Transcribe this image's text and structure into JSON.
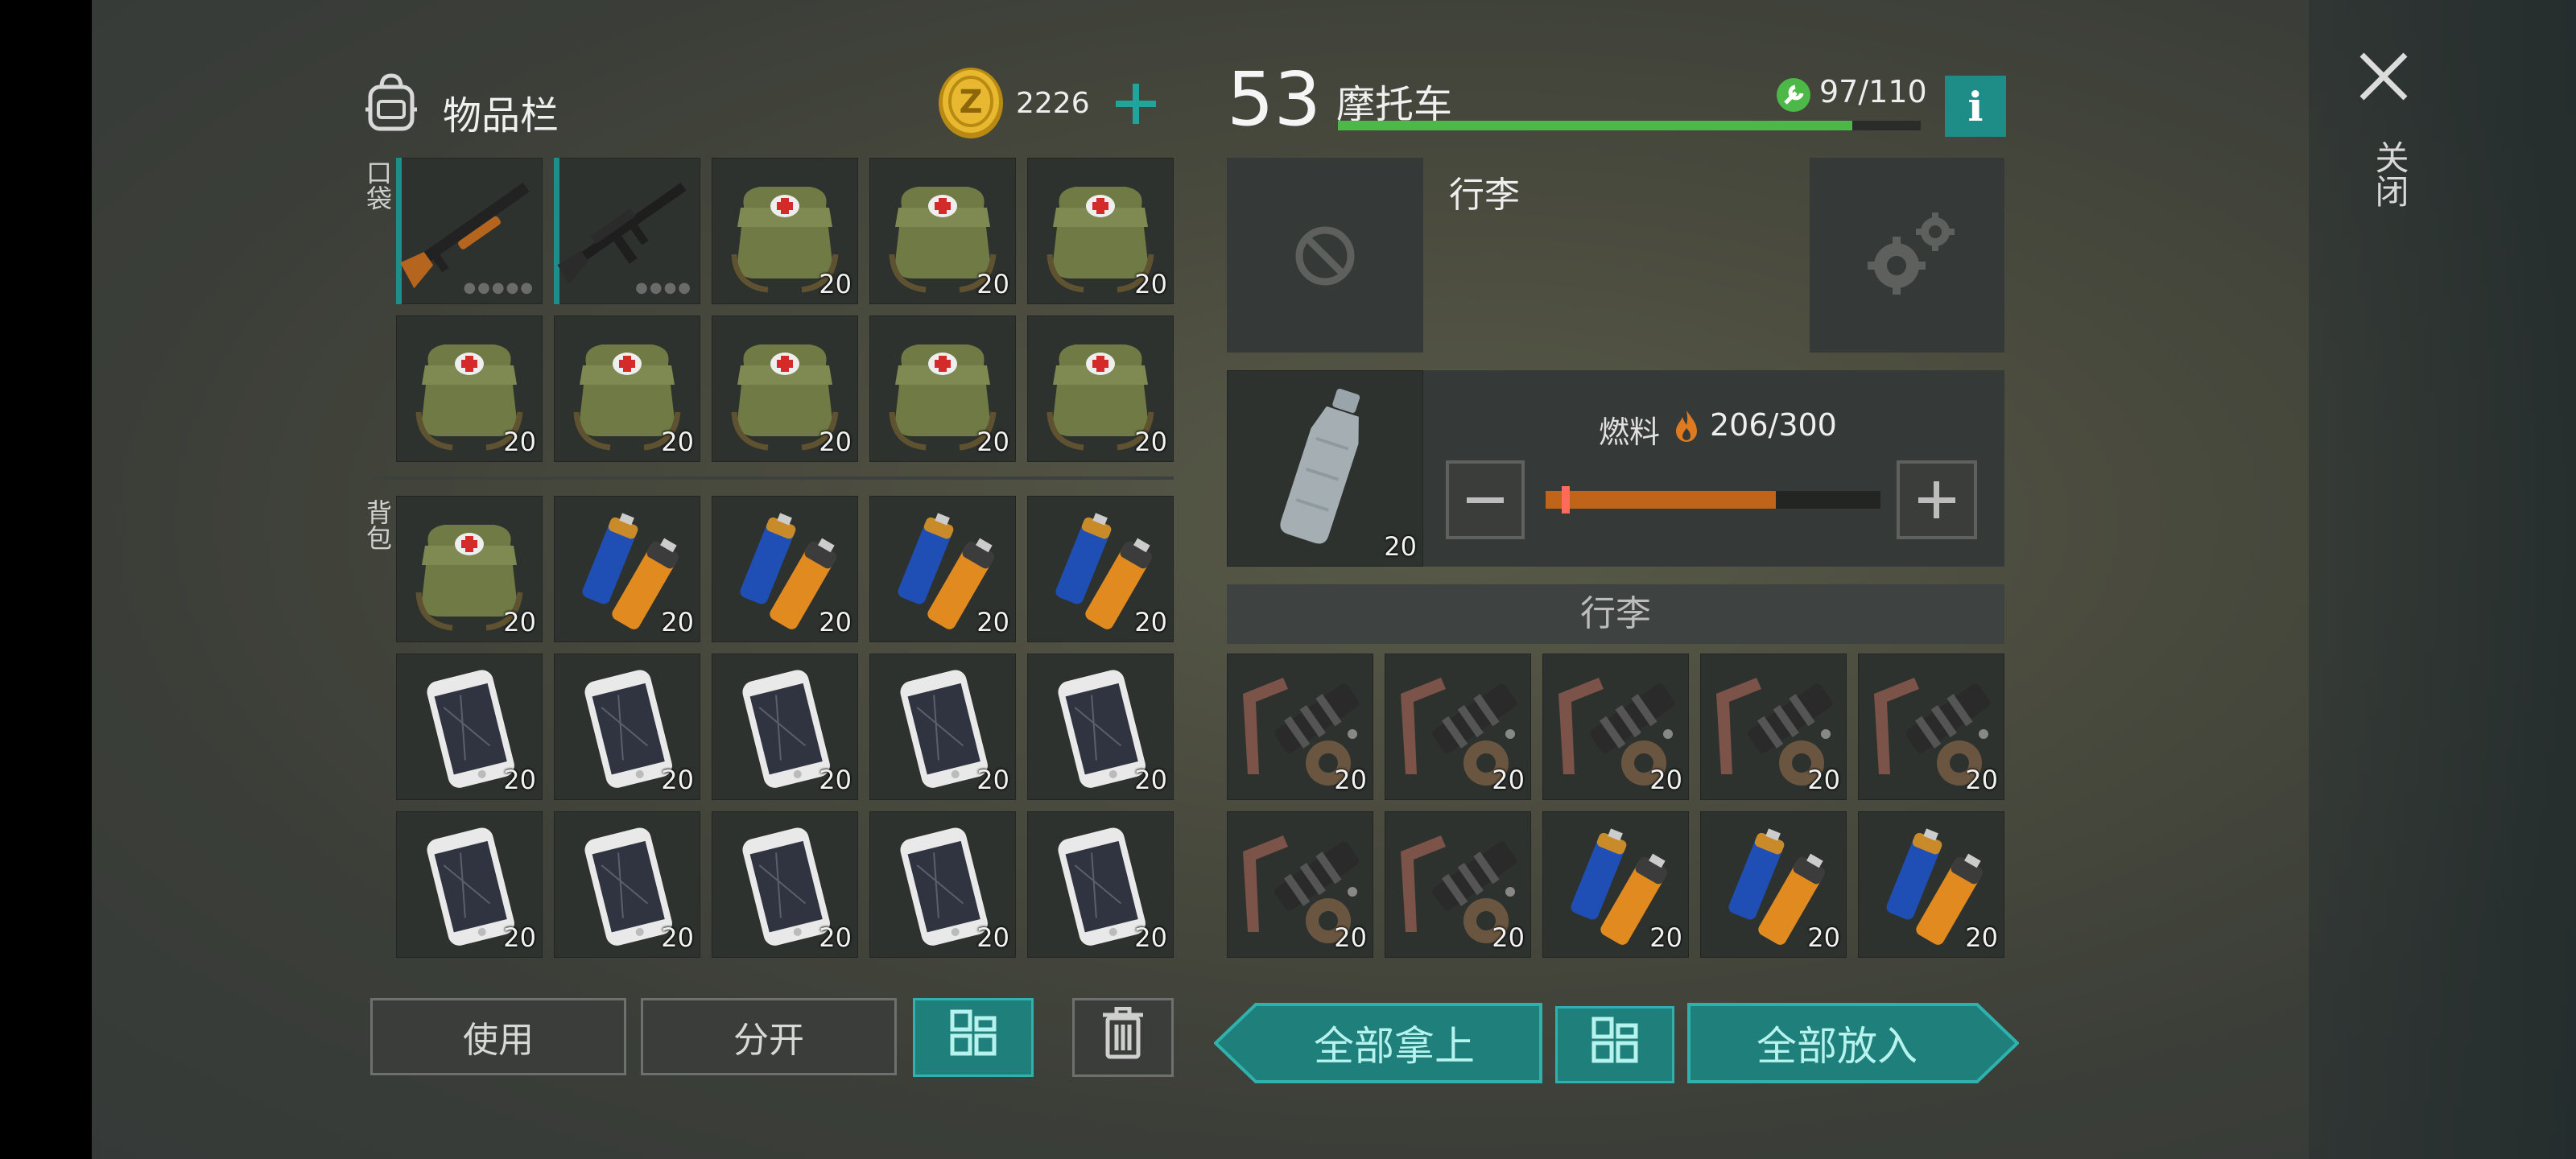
{
  "inventory": {
    "title": "物品栏",
    "currency": "2226",
    "pockets_label": "口袋",
    "backpack_label": "背包",
    "pockets": [
      {
        "icon": "shotgun-icon",
        "equipped": true,
        "dots": "●●●●●"
      },
      {
        "icon": "rifle-icon",
        "equipped": true,
        "dots": "●●●●"
      },
      {
        "icon": "medkit-icon",
        "qty": "20"
      },
      {
        "icon": "medkit-icon",
        "qty": "20"
      },
      {
        "icon": "medkit-icon",
        "qty": "20"
      },
      {
        "icon": "medkit-icon",
        "qty": "20"
      },
      {
        "icon": "medkit-icon",
        "qty": "20"
      },
      {
        "icon": "medkit-icon",
        "qty": "20"
      },
      {
        "icon": "medkit-icon",
        "qty": "20"
      },
      {
        "icon": "medkit-icon",
        "qty": "20"
      }
    ],
    "backpack": [
      {
        "icon": "medkit-icon",
        "qty": "20"
      },
      {
        "icon": "battery-icon",
        "qty": "20"
      },
      {
        "icon": "battery-icon",
        "qty": "20"
      },
      {
        "icon": "battery-icon",
        "qty": "20"
      },
      {
        "icon": "battery-icon",
        "qty": "20"
      },
      {
        "icon": "phone-icon",
        "qty": "20"
      },
      {
        "icon": "phone-icon",
        "qty": "20"
      },
      {
        "icon": "phone-icon",
        "qty": "20"
      },
      {
        "icon": "phone-icon",
        "qty": "20"
      },
      {
        "icon": "phone-icon",
        "qty": "20"
      },
      {
        "icon": "phone-icon",
        "qty": "20"
      },
      {
        "icon": "phone-icon",
        "qty": "20"
      },
      {
        "icon": "phone-icon",
        "qty": "20"
      },
      {
        "icon": "phone-icon",
        "qty": "20"
      },
      {
        "icon": "phone-icon",
        "qty": "20"
      }
    ],
    "use_label": "使用",
    "split_label": "分开"
  },
  "vehicle": {
    "level": "53",
    "name": "摩托车",
    "durability": "97/110",
    "durability_fraction": 0.882,
    "info_label": "i",
    "luggage_slot_label": "行李",
    "fuel_label": "燃料",
    "fuel_value": "206/300",
    "fuel_fraction": 0.687,
    "fuel_item_qty": "20",
    "luggage_header": "行李",
    "luggage": [
      {
        "icon": "motor-parts-icon",
        "qty": "20"
      },
      {
        "icon": "motor-parts-icon",
        "qty": "20"
      },
      {
        "icon": "motor-parts-icon",
        "qty": "20"
      },
      {
        "icon": "motor-parts-icon",
        "qty": "20"
      },
      {
        "icon": "motor-parts-icon",
        "qty": "20"
      },
      {
        "icon": "motor-parts-icon",
        "qty": "20"
      },
      {
        "icon": "motor-parts-icon",
        "qty": "20"
      },
      {
        "icon": "battery-icon",
        "qty": "20"
      },
      {
        "icon": "battery-icon",
        "qty": "20"
      },
      {
        "icon": "battery-icon",
        "qty": "20"
      }
    ],
    "take_all_label": "全部拿上",
    "put_all_label": "全部放入"
  },
  "close_label": "关闭",
  "colors": {
    "accent": "#1f7f7b",
    "durability": "#4cb847",
    "fuel": "#c0641a"
  }
}
